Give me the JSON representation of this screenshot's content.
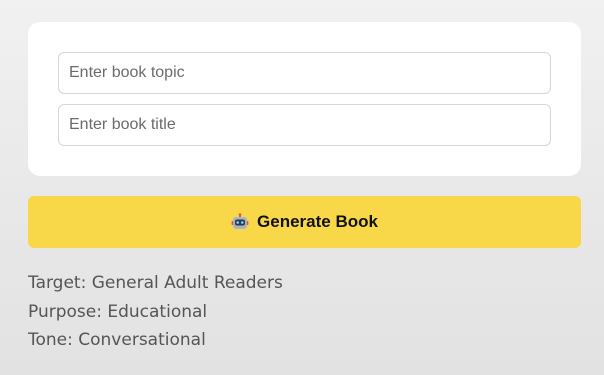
{
  "form": {
    "topic_placeholder": "Enter book topic",
    "topic_value": "",
    "title_placeholder": "Enter book title",
    "title_value": ""
  },
  "generate_button": {
    "label": "Generate Book",
    "icon": "robot-icon",
    "color": "#f8d849"
  },
  "info": {
    "target": "Target: General Adult Readers",
    "purpose": "Purpose: Educational",
    "tone": "Tone: Conversational"
  }
}
